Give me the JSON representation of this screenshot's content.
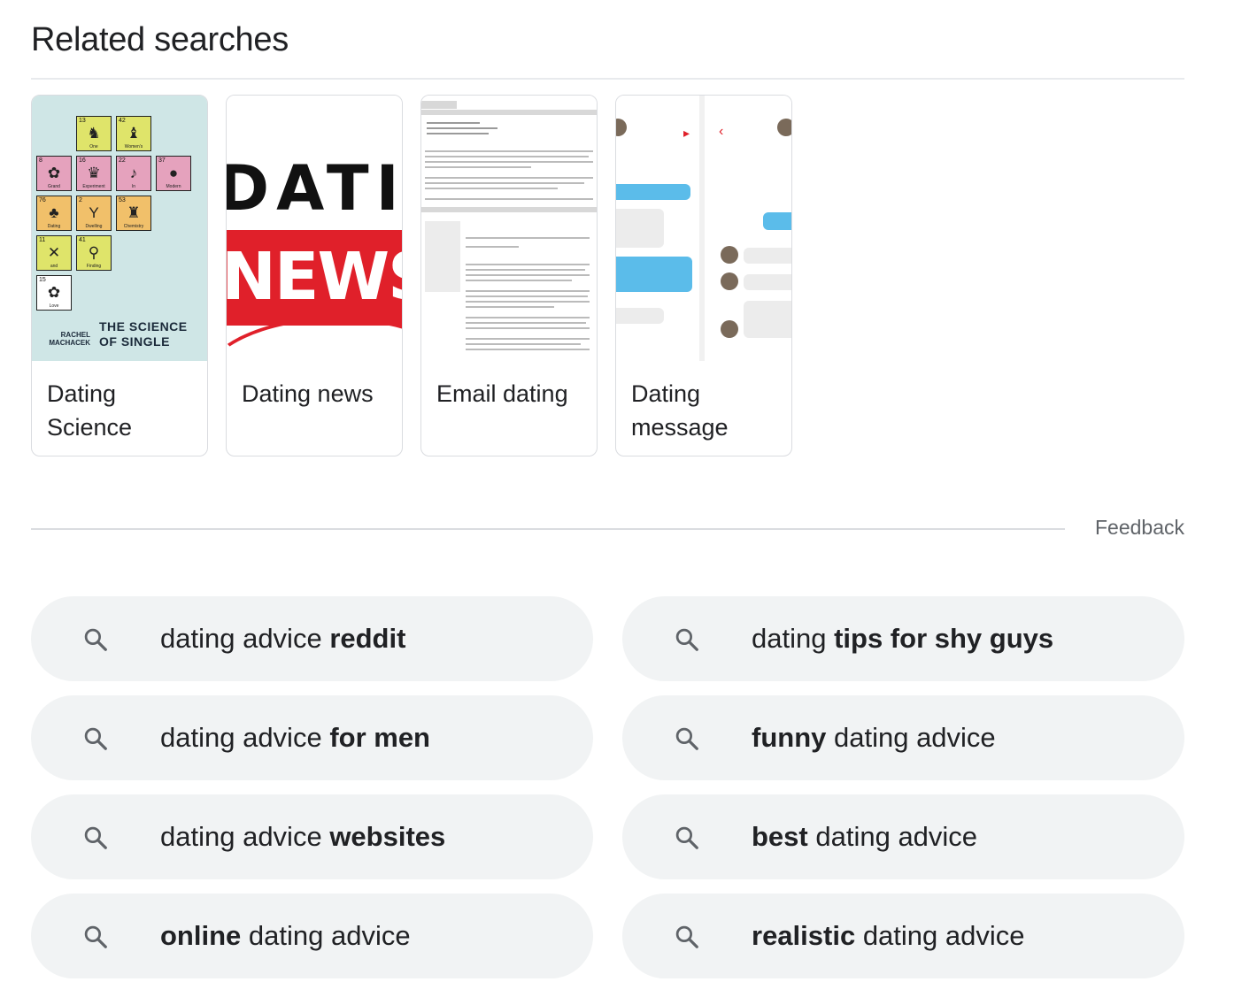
{
  "title": "Related searches",
  "cards": [
    {
      "label": "Dating Science",
      "label_line1": "Dating",
      "label_line2": "Science",
      "thumb": {
        "cover_title_1": "THE SCIENCE",
        "cover_title_2": "OF SINGLE",
        "author_1": "RACHEL",
        "author_2": "MACHACEK",
        "tiles": [
          {
            "n": "13",
            "w": "One"
          },
          {
            "n": "42",
            "w": "Women's"
          },
          {
            "n": "8",
            "w": "Grand"
          },
          {
            "n": "16",
            "w": "Experiment"
          },
          {
            "n": "22",
            "w": "In"
          },
          {
            "n": "37",
            "w": "Modern"
          },
          {
            "n": "76",
            "w": "Dating"
          },
          {
            "n": "2",
            "w": "Dwelling"
          },
          {
            "n": "53",
            "w": "Chemistry"
          },
          {
            "n": "11",
            "w": "and"
          },
          {
            "n": "41",
            "w": "Finding"
          },
          {
            "n": "15",
            "w": "Love"
          }
        ]
      }
    },
    {
      "label": "Dating news",
      "thumb": {
        "word1": "DATIN",
        "word2": "NEWS"
      }
    },
    {
      "label": "Email dating"
    },
    {
      "label": "Dating message",
      "label_line1": "Dating",
      "label_line2": "message"
    }
  ],
  "feedback": "Feedback",
  "chips": [
    {
      "pre": "dating advice ",
      "bold": "reddit",
      "post": ""
    },
    {
      "pre": "dating ",
      "bold": "tips for shy guys",
      "post": ""
    },
    {
      "pre": "dating advice ",
      "bold": "for men",
      "post": ""
    },
    {
      "pre": "",
      "bold": "funny",
      "post": " dating advice"
    },
    {
      "pre": "dating advice ",
      "bold": "websites",
      "post": ""
    },
    {
      "pre": "",
      "bold": "best",
      "post": " dating advice"
    },
    {
      "pre": "",
      "bold": "online",
      "post": " dating advice"
    },
    {
      "pre": "",
      "bold": "realistic",
      "post": " dating advice"
    }
  ],
  "icons": {
    "chip_icon": "search-icon"
  },
  "colors": {
    "chip_bg": "#f1f3f4",
    "news_red": "#e0202a",
    "chat_blue": "#5bbcea"
  }
}
